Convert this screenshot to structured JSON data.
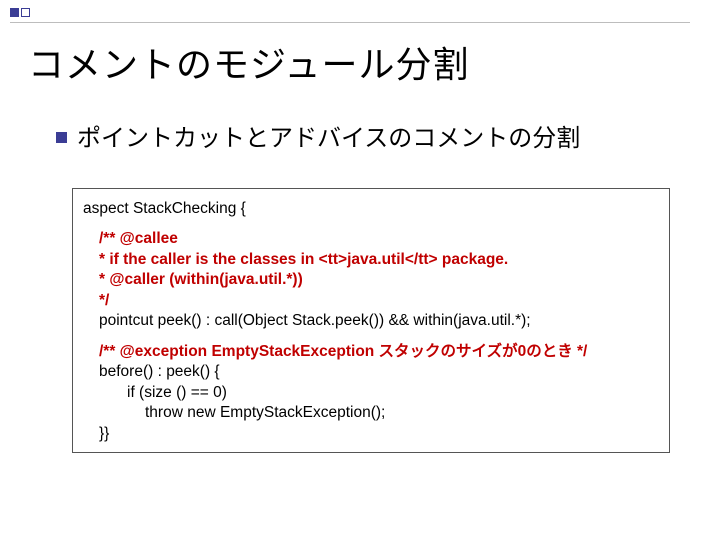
{
  "slide": {
    "title": "コメントのモジュール分割",
    "bullet": "ポイントカットとアドバイスのコメントの分割"
  },
  "code": {
    "l1": "aspect StackChecking {",
    "c1": "/**   @callee",
    "c2": "  *         if the caller is the classes in <tt>java.util</tt> package.",
    "c3": "  *     @caller (within(java.util.*))",
    "c4": "  */",
    "l2": "pointcut peek() : call(Object Stack.peek()) && within(java.util.*);",
    "c5": "/**  @exception  EmptyStackException スタックのサイズが0のとき  */",
    "l3": "before() : peek()  {",
    "l4": "if (size () == 0)",
    "l5": "throw new EmptyStackException();",
    "l6": "}}"
  }
}
